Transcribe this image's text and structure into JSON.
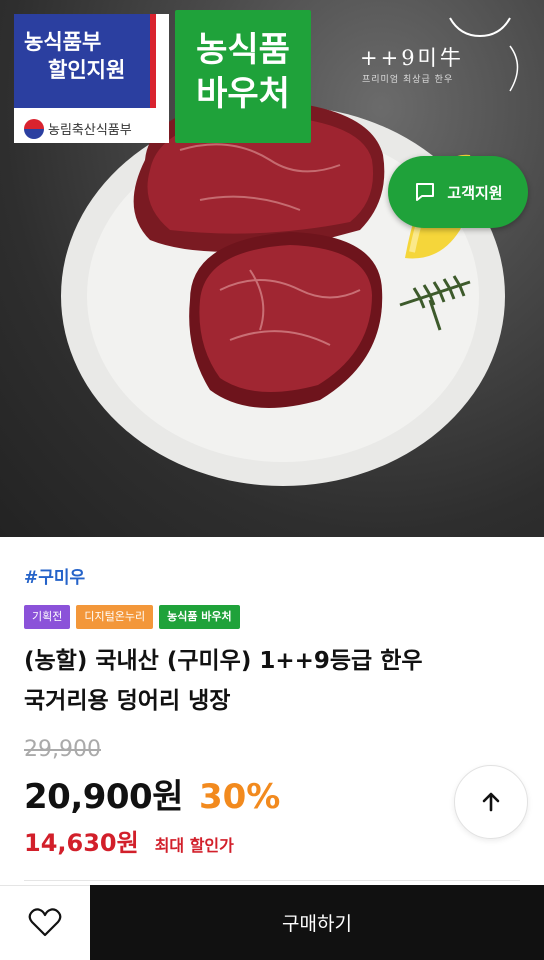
{
  "hero": {
    "ministry_badge": {
      "line1": "농식품부",
      "line2": "할인지원",
      "gov_name": "농림축산식품부"
    },
    "voucher_badge": {
      "line1": "농식품",
      "line2": "바우처"
    },
    "brand": {
      "name": "++9미牛",
      "subtitle": "프리미엄 최상급 한우"
    },
    "support_button": {
      "label": "고객지원",
      "icon": "chat-bubble-icon"
    }
  },
  "product": {
    "hashtag": "#구미우",
    "tags": [
      {
        "label": "기획전",
        "color": "#8b52d9"
      },
      {
        "label": "디지털온누리",
        "color": "#f3973a"
      },
      {
        "label": "농식품 바우처",
        "color": "#1fa23a"
      }
    ],
    "title_line1": "(농할) 국내산 (구미우) 1++9등급 한우",
    "title_line2": "국거리용 덩어리 냉장",
    "original_price": "29,900",
    "price": "20,900원",
    "discount": "30%",
    "max_discount_price": "14,630원",
    "max_discount_label": "최대 할인가"
  },
  "actions": {
    "scroll_top_icon": "arrow-up-icon",
    "wishlist_icon": "heart-icon",
    "buy_label": "구매하기"
  },
  "colors": {
    "accent_green": "#1fa23a",
    "hashtag_blue": "#2563c9",
    "discount_orange": "#f28a1e",
    "max_price_red": "#d21f2a"
  }
}
